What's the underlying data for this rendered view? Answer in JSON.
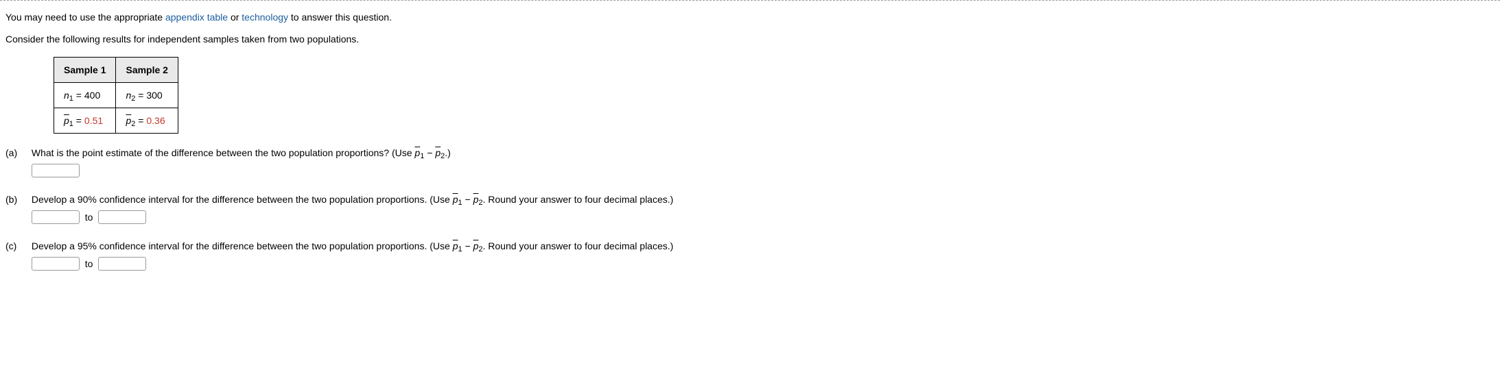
{
  "intro_prefix": "You may need to use the appropriate ",
  "link_appendix": "appendix table",
  "intro_mid": " or ",
  "link_technology": "technology",
  "intro_suffix": " to answer this question.",
  "consider": "Consider the following results for independent samples taken from two populations.",
  "table": {
    "head1": "Sample 1",
    "head2": "Sample 2",
    "n1_label_var": "n",
    "n1_label_sub": "1",
    "n1_eq": " = 400",
    "n2_label_var": "n",
    "n2_label_sub": "2",
    "n2_eq": " = 300",
    "p1_label_var": "p",
    "p1_label_sub": "1",
    "p1_eq_eq": " = ",
    "p1_val": "0.51",
    "p2_label_var": "p",
    "p2_label_sub": "2",
    "p2_eq_eq": " = ",
    "p2_val": "0.36"
  },
  "parts": {
    "a": {
      "label": "(a)",
      "text_pre": "What is the point estimate of the difference between the two population proportions? (Use ",
      "p1": "p",
      "p1sub": "1",
      "minus": " − ",
      "p2": "p",
      "p2sub": "2",
      "text_post": ".)"
    },
    "b": {
      "label": "(b)",
      "text_pre": "Develop a 90% confidence interval for the difference between the two population proportions. (Use ",
      "p1": "p",
      "p1sub": "1",
      "minus": " − ",
      "p2": "p",
      "p2sub": "2",
      "text_post": ". Round your answer to four decimal places.)",
      "to": "to"
    },
    "c": {
      "label": "(c)",
      "text_pre": "Develop a 95% confidence interval for the difference between the two population proportions. (Use ",
      "p1": "p",
      "p1sub": "1",
      "minus": " − ",
      "p2": "p",
      "p2sub": "2",
      "text_post": ". Round your answer to four decimal places.)",
      "to": "to"
    }
  },
  "answers": {
    "a": "",
    "b_low": "",
    "b_high": "",
    "c_low": "",
    "c_high": ""
  }
}
